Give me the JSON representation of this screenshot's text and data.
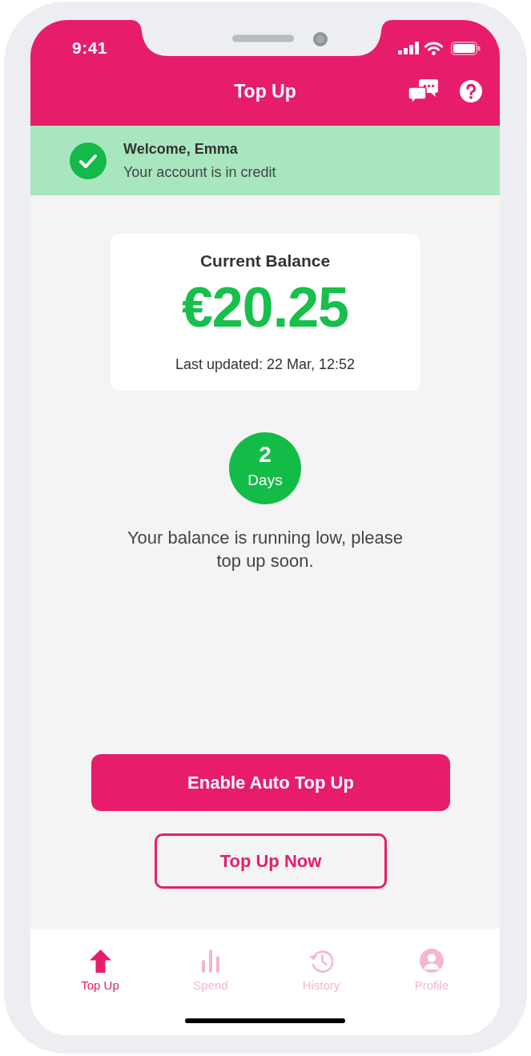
{
  "status_bar": {
    "time": "9:41"
  },
  "header": {
    "title": "Top Up"
  },
  "banner": {
    "title": "Welcome, Emma",
    "message": "Your account is in credit"
  },
  "balance_card": {
    "label": "Current Balance",
    "amount": "€20.25",
    "updated": "Last updated: 22 Mar, 12:52"
  },
  "days_remaining": {
    "count": "2",
    "unit": "Days"
  },
  "notice": "Your balance is running low, please top up soon.",
  "actions": [
    {
      "kind": "primary",
      "label": "Enable Auto Top Up"
    },
    {
      "kind": "secondary",
      "label": "Top Up Now"
    }
  ],
  "tab_bar": [
    {
      "label": "Top Up",
      "selected": true
    },
    {
      "label": "Spend",
      "selected": false
    },
    {
      "label": "History",
      "selected": false
    },
    {
      "label": "Profile",
      "selected": false
    }
  ]
}
